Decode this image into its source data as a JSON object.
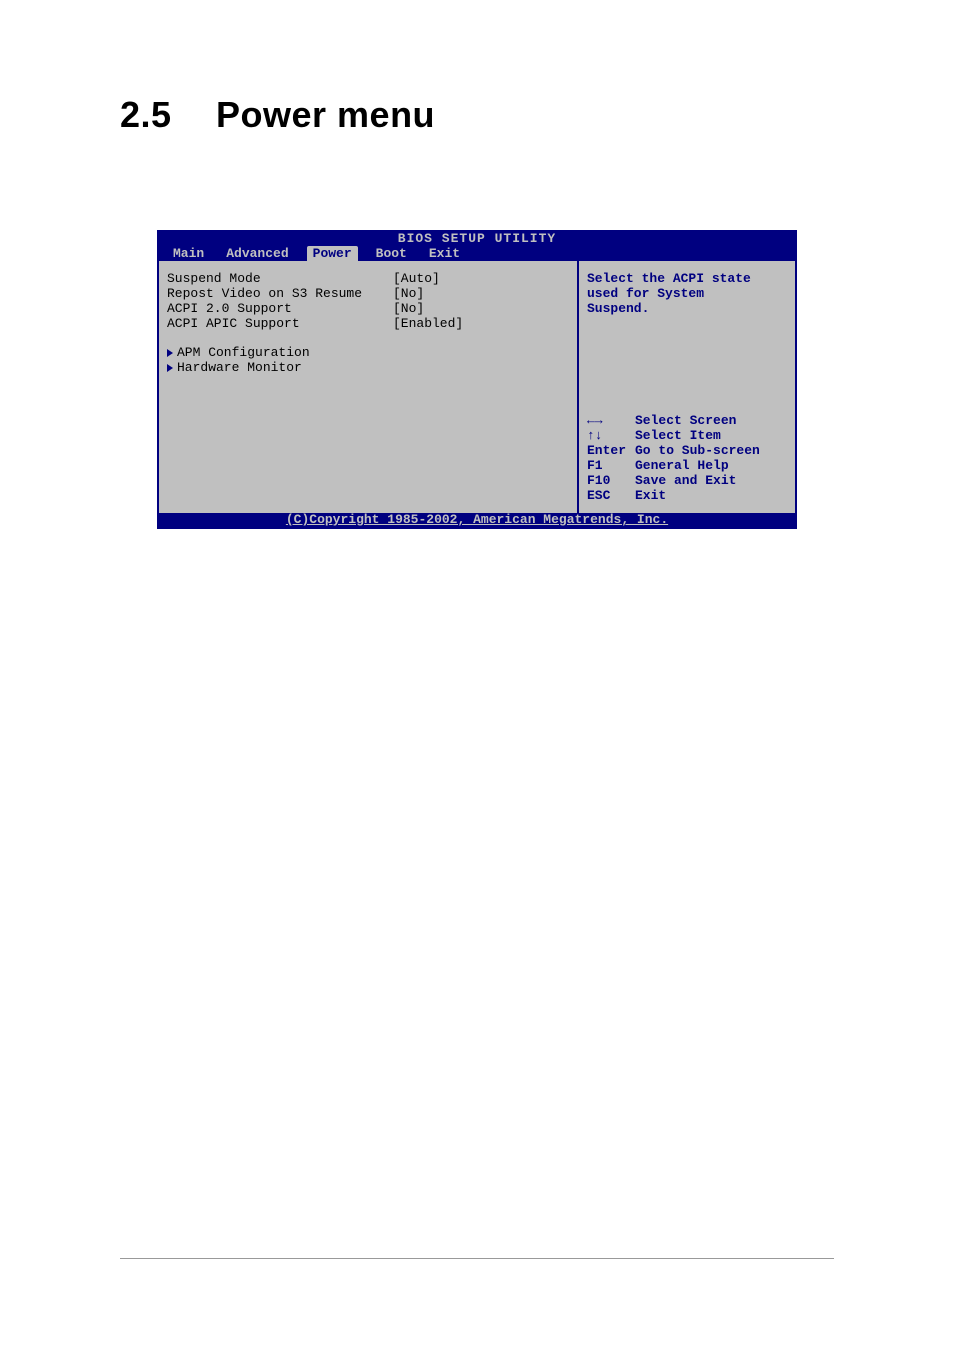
{
  "heading": {
    "num": "2.5",
    "title": "Power menu"
  },
  "bios": {
    "title": "BIOS SETUP UTILITY",
    "tabs": [
      "Main",
      "Advanced",
      "Power",
      "Boot",
      "Exit"
    ],
    "active_tab": 2,
    "options": [
      {
        "label": "Suspend Mode",
        "value": "[Auto]"
      },
      {
        "label": "Repost Video on S3 Resume",
        "value": "[No]"
      },
      {
        "label": "ACPI 2.0 Support",
        "value": "[No]"
      },
      {
        "label": "ACPI APIC Support",
        "value": "[Enabled]"
      }
    ],
    "submenus": [
      {
        "label": "APM Configuration"
      },
      {
        "label": "Hardware Monitor"
      }
    ],
    "help": {
      "line1": "Select the ACPI state",
      "line2": "used for System",
      "line3": "Suspend."
    },
    "keys": [
      {
        "key": "←→",
        "action": "Select Screen",
        "type": "lr"
      },
      {
        "key": "↑↓",
        "action": "Select Item",
        "type": "ud"
      },
      {
        "key": "Enter",
        "action": "Go to Sub-screen"
      },
      {
        "key": "F1",
        "action": "General Help"
      },
      {
        "key": "F10",
        "action": "Save and Exit"
      },
      {
        "key": "ESC",
        "action": "Exit"
      }
    ],
    "footer": "(C)Copyright 1985-2002, American Megatrends, Inc."
  }
}
